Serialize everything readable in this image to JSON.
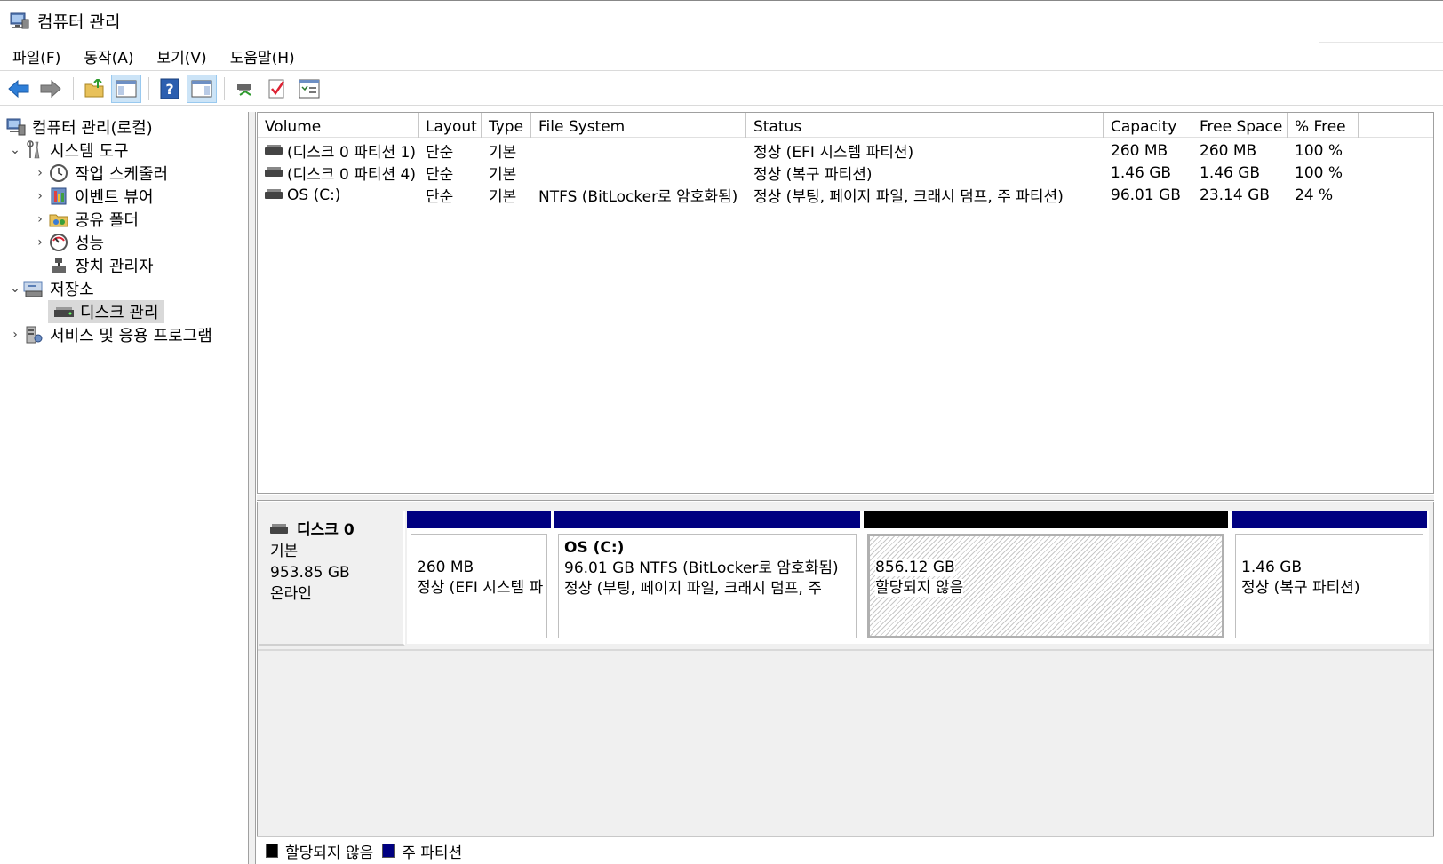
{
  "window": {
    "title": "컴퓨터 관리"
  },
  "menu": [
    "파일(F)",
    "동작(A)",
    "보기(V)",
    "도움말(H)"
  ],
  "toolbar": {
    "icons": [
      "back-arrow-icon",
      "forward-arrow-icon",
      "folder-up-icon",
      "show-hide-tree-icon",
      "help-icon",
      "action-pane-icon",
      "connect-icon",
      "check-icon",
      "properties-icon"
    ]
  },
  "tree": {
    "root": "컴퓨터 관리(로컬)",
    "system_tools": "시스템 도구",
    "task_scheduler": "작업 스케줄러",
    "event_viewer": "이벤트 뷰어",
    "shared_folders": "공유 폴더",
    "performance": "성능",
    "device_manager": "장치 관리자",
    "storage": "저장소",
    "disk_management": "디스크 관리",
    "services_apps": "서비스 및 응용 프로그램"
  },
  "volumes": {
    "headers": [
      "Volume",
      "Layout",
      "Type",
      "File System",
      "Status",
      "Capacity",
      "Free Space",
      "% Free"
    ],
    "rows": [
      [
        "(디스크 0 파티션 1)",
        "단순",
        "기본",
        "",
        "정상 (EFI 시스템 파티션)",
        "260 MB",
        "260 MB",
        "100 %"
      ],
      [
        "(디스크 0 파티션 4)",
        "단순",
        "기본",
        "",
        "정상 (복구 파티션)",
        "1.46 GB",
        "1.46 GB",
        "100 %"
      ],
      [
        "OS (C:)",
        "단순",
        "기본",
        "NTFS (BitLocker로 암호화됨)",
        "정상 (부팅, 페이지 파일, 크래시 덤프, 주 파티션)",
        "96.01 GB",
        "23.14 GB",
        "24 %"
      ]
    ]
  },
  "disk0": {
    "name": "디스크 0",
    "type": "기본",
    "size": "953.85 GB",
    "state": "온라인",
    "partitions": [
      {
        "title": "",
        "line1": "260 MB",
        "line2": "정상 (EFI 시스템 파",
        "color": "#000080"
      },
      {
        "title": "OS  (C:)",
        "line1": "96.01 GB NTFS (BitLocker로 암호화됨)",
        "line2": "정상 (부팅, 페이지 파일, 크래시 덤프, 주",
        "color": "#000080"
      },
      {
        "title": "",
        "line1": "856.12 GB",
        "line2": "할당되지 않음",
        "color": "#000000"
      },
      {
        "title": "",
        "line1": "1.46 GB",
        "line2": "정상 (복구 파티션)",
        "color": "#000080"
      }
    ]
  },
  "legend": [
    {
      "label": "할당되지 않음",
      "color": "#000000"
    },
    {
      "label": "주 파티션",
      "color": "#000080"
    }
  ]
}
